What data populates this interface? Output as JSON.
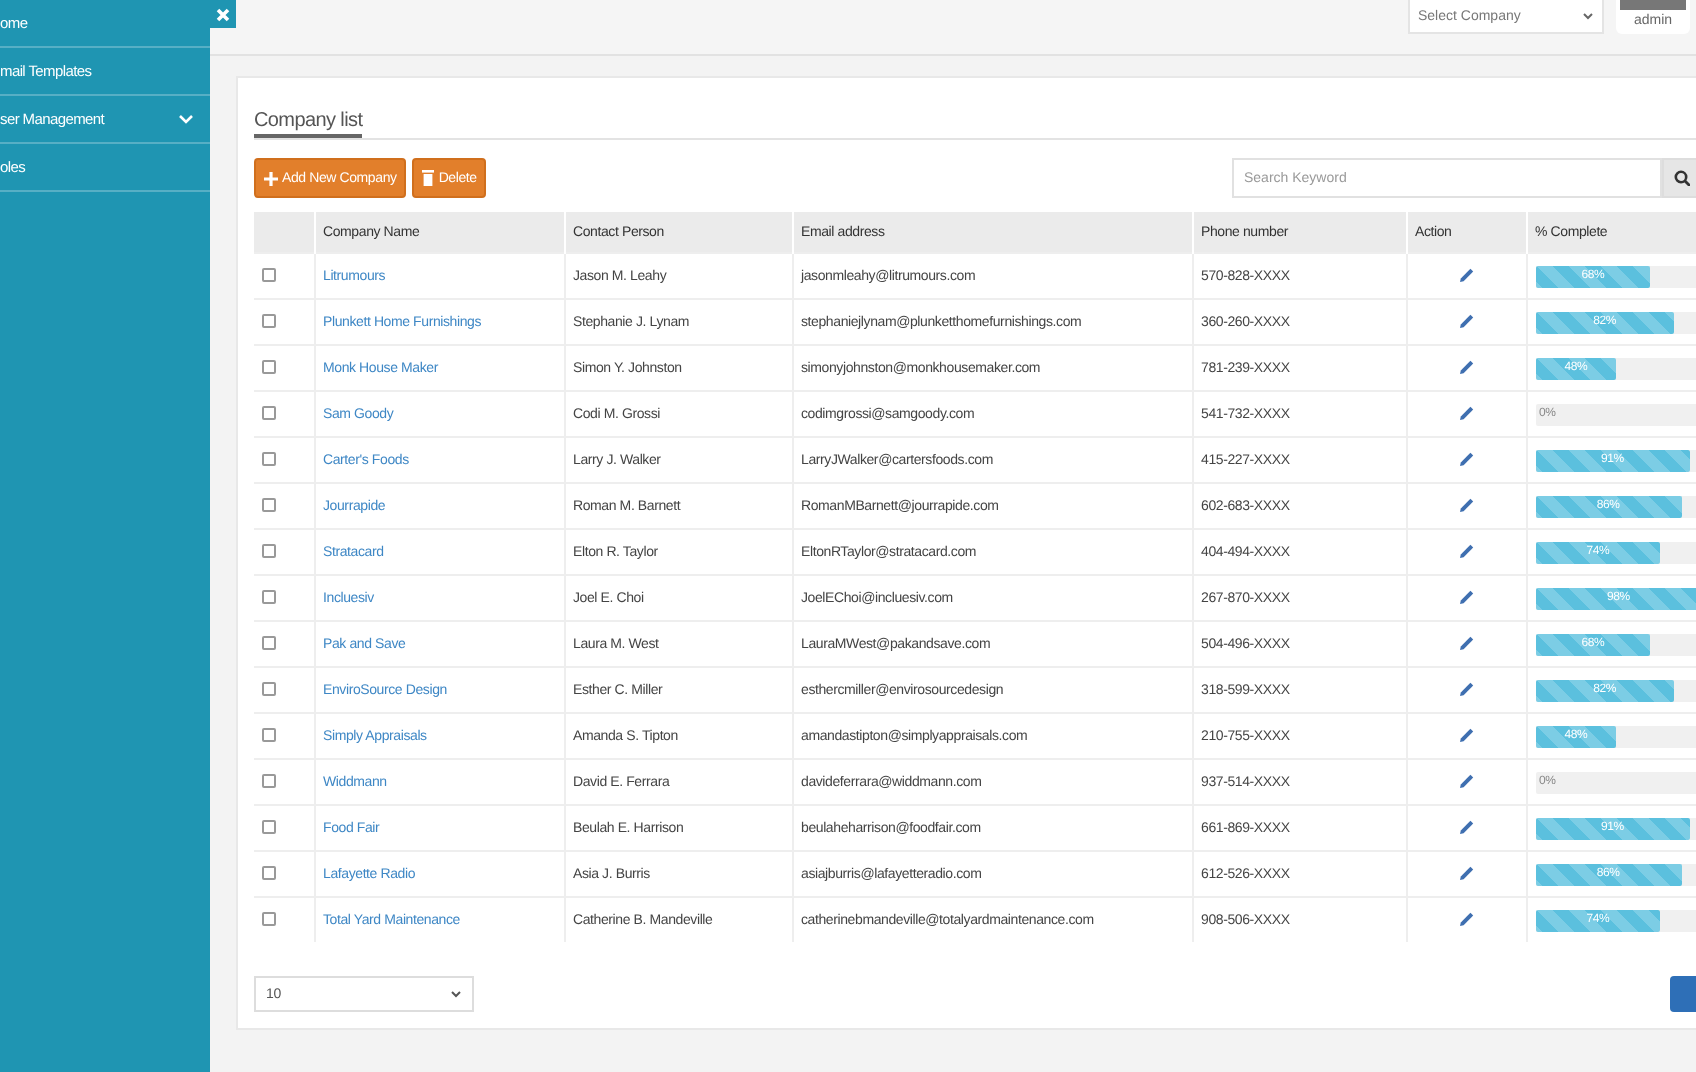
{
  "sidebar": {
    "items": [
      {
        "label": "ome",
        "has_submenu": false
      },
      {
        "label": "mail Templates",
        "has_submenu": false
      },
      {
        "label": "ser Management",
        "has_submenu": true
      },
      {
        "label": "oles",
        "has_submenu": false
      }
    ]
  },
  "header": {
    "company_select": {
      "placeholder": "Select Company"
    },
    "user": "admin"
  },
  "card": {
    "title": "Company list",
    "buttons": [
      {
        "kind": "add",
        "label": "Add New Company"
      },
      {
        "kind": "delete",
        "label": "Delete"
      }
    ],
    "search": {
      "placeholder": "Search Keyword"
    },
    "table": {
      "columns": [
        "Company Name",
        "Contact Person",
        "Email address",
        "Phone number",
        "Action",
        "% Complete"
      ],
      "rows": [
        {
          "checked": false,
          "company": "Litrumours",
          "contact": "Jason M. Leahy",
          "email": "jasonmleahy@litrumours.com",
          "phone": "570-828-XXXX",
          "level": 0.68,
          "reading": "68%"
        },
        {
          "checked": false,
          "company": "Plunkett Home Furnishings",
          "contact": "Stephanie J. Lynam",
          "email": "stephaniejlynam@plunketthomefurnishings.com",
          "phone": "360-260-XXXX",
          "level": 0.82,
          "reading": "82%"
        },
        {
          "checked": false,
          "company": "Monk House Maker",
          "contact": "Simon Y. Johnston",
          "email": "simonyjohnston@monkhousemaker.com",
          "phone": "781-239-XXXX",
          "level": 0.48,
          "reading": "48%"
        },
        {
          "checked": false,
          "company": "Sam Goody",
          "contact": "Codi M. Grossi",
          "email": "codimgrossi@samgoody.com",
          "phone": "541-732-XXXX",
          "level": 0,
          "reading": "0%"
        },
        {
          "checked": false,
          "company": "Carter's Foods",
          "contact": "Larry J. Walker",
          "email": "LarryJWalker@cartersfoods.com",
          "phone": "415-227-XXXX",
          "level": 0.91,
          "reading": "91%"
        },
        {
          "checked": false,
          "company": "Jourrapide",
          "contact": "Roman M. Barnett",
          "email": "RomanMBarnett@jourrapide.com",
          "phone": "602-683-XXXX",
          "level": 0.86,
          "reading": "86%"
        },
        {
          "checked": false,
          "company": "Stratacard",
          "contact": "Elton R. Taylor",
          "email": "EltonRTaylor@stratacard.com",
          "phone": "404-494-XXXX",
          "level": 0.74,
          "reading": "74%"
        },
        {
          "checked": false,
          "company": "Incluesiv",
          "contact": "Joel E. Choi",
          "email": "JoelEChoi@incluesiv.com",
          "phone": "267-870-XXXX",
          "level": 0.98,
          "reading": "98%"
        },
        {
          "checked": false,
          "company": "Pak and Save",
          "contact": "Laura M. West",
          "email": "LauraMWest@pakandsave.com",
          "phone": "504-496-XXXX",
          "level": 0.68,
          "reading": "68%"
        },
        {
          "checked": false,
          "company": "EnviroSource Design",
          "contact": "Esther C. Miller",
          "email": "esthercmiller@envirosourcedesign",
          "phone": "318-599-XXXX",
          "level": 0.82,
          "reading": "82%"
        },
        {
          "checked": false,
          "company": "Simply Appraisals",
          "contact": "Amanda S. Tipton",
          "email": "amandastipton@simplyappraisals.com",
          "phone": "210-755-XXXX",
          "level": 0.48,
          "reading": "48%"
        },
        {
          "checked": false,
          "company": "Widdmann",
          "contact": "David E. Ferrara",
          "email": "davideferrara@widdmann.com",
          "phone": "937-514-XXXX",
          "level": 0,
          "reading": "0%"
        },
        {
          "checked": false,
          "company": "Food Fair",
          "contact": "Beulah E. Harrison",
          "email": "beulaheharrison@foodfair.com",
          "phone": "661-869-XXXX",
          "level": 0.91,
          "reading": "91%"
        },
        {
          "checked": false,
          "company": "Lafayette Radio",
          "contact": "Asia J. Burris",
          "email": "asiajburris@lafayetteradio.com",
          "phone": "612-526-XXXX",
          "level": 0.86,
          "reading": "86%"
        },
        {
          "checked": false,
          "company": "Total Yard Maintenance",
          "contact": "Catherine B. Mandeville",
          "email": "catherinebmandeville@totalyardmaintenance.com",
          "phone": "908-506-XXXX",
          "level": 0.74,
          "reading": "74%"
        }
      ]
    },
    "page_size": "10"
  }
}
